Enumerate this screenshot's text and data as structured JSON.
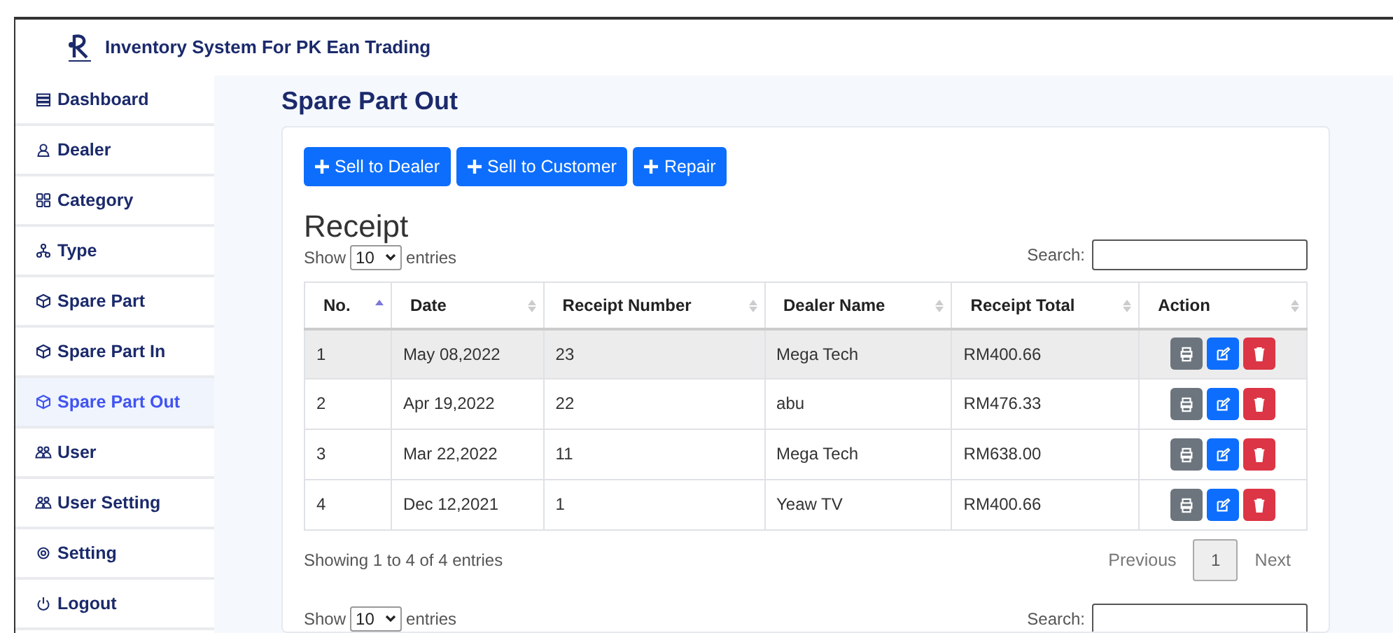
{
  "header": {
    "title": "Inventory System For PK Ean Trading"
  },
  "sidebar": {
    "items": [
      {
        "label": "Dashboard",
        "selected": false
      },
      {
        "label": "Dealer",
        "selected": false
      },
      {
        "label": "Category",
        "selected": false
      },
      {
        "label": "Type",
        "selected": false
      },
      {
        "label": "Spare Part",
        "selected": false
      },
      {
        "label": "Spare Part In",
        "selected": false
      },
      {
        "label": "Spare Part Out",
        "selected": true
      },
      {
        "label": "User",
        "selected": false
      },
      {
        "label": "User Setting",
        "selected": false
      },
      {
        "label": "Setting",
        "selected": false
      },
      {
        "label": "Logout",
        "selected": false
      }
    ]
  },
  "page_title": "Spare Part Out",
  "buttons": [
    "Sell to Dealer",
    "Sell to Customer",
    "Repair"
  ],
  "section_title": "Receipt",
  "length": {
    "show": "Show",
    "value": "10",
    "entries": "entries"
  },
  "search": {
    "label": "Search:"
  },
  "table": {
    "columns": [
      {
        "label": "No.",
        "sorted": true
      },
      {
        "label": "Date",
        "sorted": false
      },
      {
        "label": "Receipt Number",
        "sorted": false
      },
      {
        "label": "Dealer Name",
        "sorted": false
      },
      {
        "label": "Receipt Total",
        "sorted": false
      },
      {
        "label": "Action",
        "sorted": false
      }
    ],
    "rows": [
      {
        "cells": [
          "1",
          "May 08,2022",
          "23",
          "Mega Tech",
          "RM400.66"
        ],
        "selected": true
      },
      {
        "cells": [
          "2",
          "Apr 19,2022",
          "22",
          "abu",
          "RM476.33"
        ],
        "selected": false
      },
      {
        "cells": [
          "3",
          "Mar 22,2022",
          "11",
          "Mega Tech",
          "RM638.00"
        ],
        "selected": false
      },
      {
        "cells": [
          "4",
          "Dec 12,2021",
          "1",
          "Yeaw TV",
          "RM400.66"
        ],
        "selected": false
      }
    ]
  },
  "info": "Showing 1 to 4 of 4 entries",
  "pagination": {
    "previous": "Previous",
    "pages": [
      {
        "label": "1",
        "selected": true
      }
    ],
    "next": "Next"
  },
  "second_length": {
    "show": "Show",
    "value": "10",
    "entries": "entries"
  },
  "second_search": {
    "label": "Search:"
  }
}
